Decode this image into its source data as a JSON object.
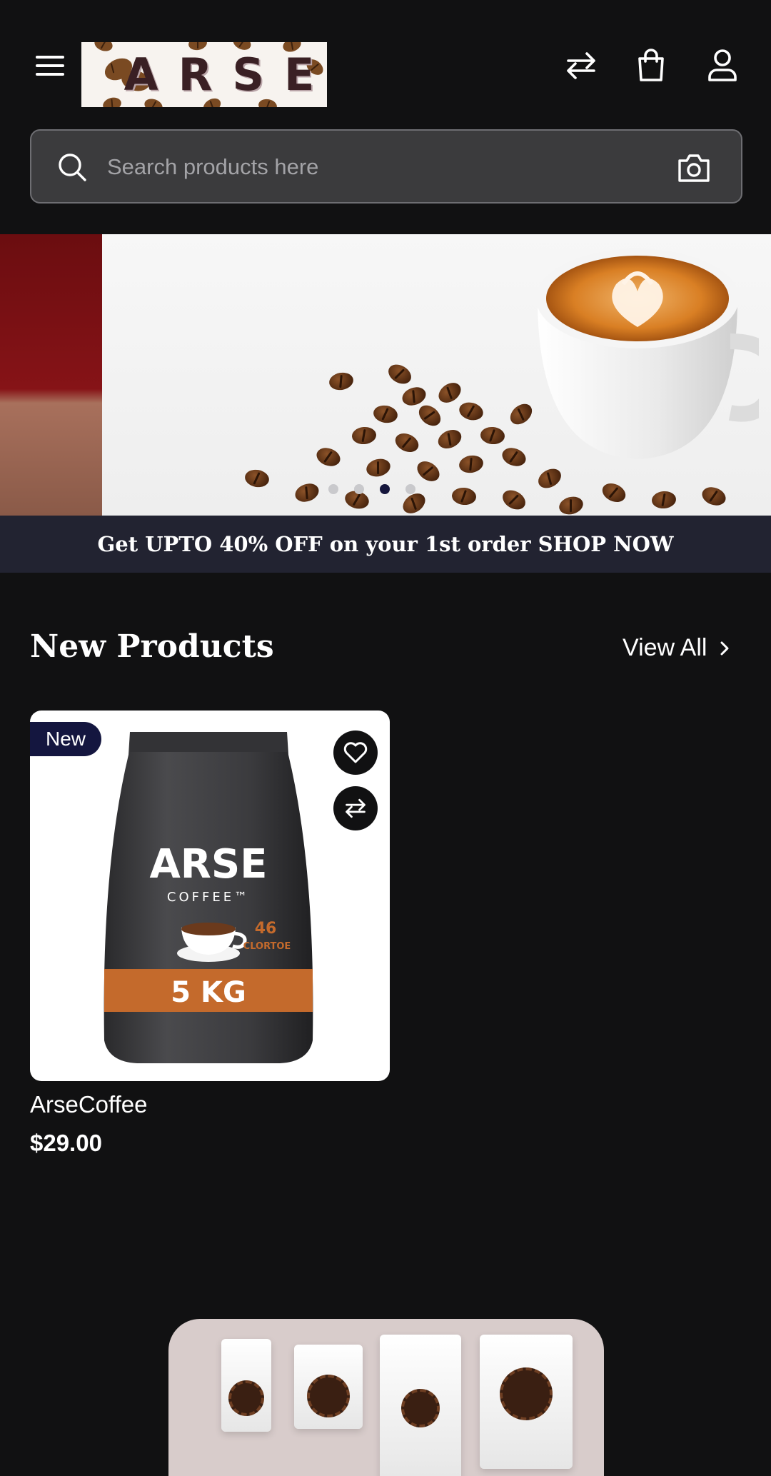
{
  "header": {
    "logo_text": "ARSE",
    "icons": [
      "menu-icon",
      "compare-icon",
      "shopping-bag-icon",
      "user-icon"
    ]
  },
  "search": {
    "placeholder": "Search products here",
    "value": ""
  },
  "banner": {
    "slide_count": 4,
    "active_slide_index": 3
  },
  "promo": {
    "text": "Get UPTO 40% OFF on your 1st order SHOP NOW"
  },
  "new_products": {
    "title": "New Products",
    "view_all_label": "View All",
    "items": [
      {
        "badge": "New",
        "name": "ArseCoffee",
        "price": "$29.00",
        "image": {
          "brand": "ARSE",
          "sub": "COFFEE™",
          "weight": "5 KG",
          "number": "46",
          "tag": "CLORTOE"
        }
      }
    ]
  },
  "colors": {
    "background": "#111112",
    "promo_bar": "#222331",
    "badge": "#14163f",
    "active_dot": "#15163c",
    "search_bg": "#3b3b3d"
  }
}
